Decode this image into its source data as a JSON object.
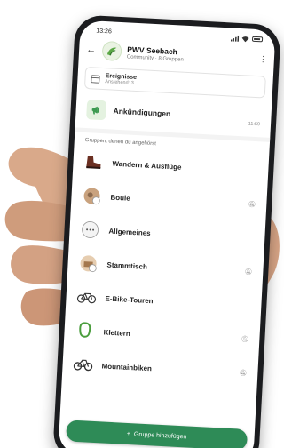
{
  "status": {
    "time": "13:26"
  },
  "header": {
    "title": "PWV Seebach",
    "subtitle": "Community · 8 Gruppen"
  },
  "events": {
    "title": "Ereignisse",
    "subtitle": "Anstehend: 3"
  },
  "announcements": {
    "label": "Ankündigungen",
    "time": "11:59"
  },
  "groups_section_label": "Gruppen, denen du angehörst",
  "groups": [
    {
      "label": "Wandern & Ausflüge",
      "icon": "hiking-boot-icon"
    },
    {
      "label": "Boule",
      "icon": "boule-avatar-icon"
    },
    {
      "label": "Allgemeines",
      "icon": "chat-bubble-icon"
    },
    {
      "label": "Stammtisch",
      "icon": "stammtisch-avatar-icon"
    },
    {
      "label": "E-Bike-Touren",
      "icon": "bicycle-icon"
    },
    {
      "label": "Klettern",
      "icon": "carabiner-icon"
    },
    {
      "label": "Mountainbiken",
      "icon": "mountain-bike-icon"
    }
  ],
  "add_group": {
    "label": "Gruppe hinzufügen",
    "icon": "plus-icon"
  },
  "colors": {
    "accent": "#2e8b57",
    "background": "#ffffff"
  }
}
